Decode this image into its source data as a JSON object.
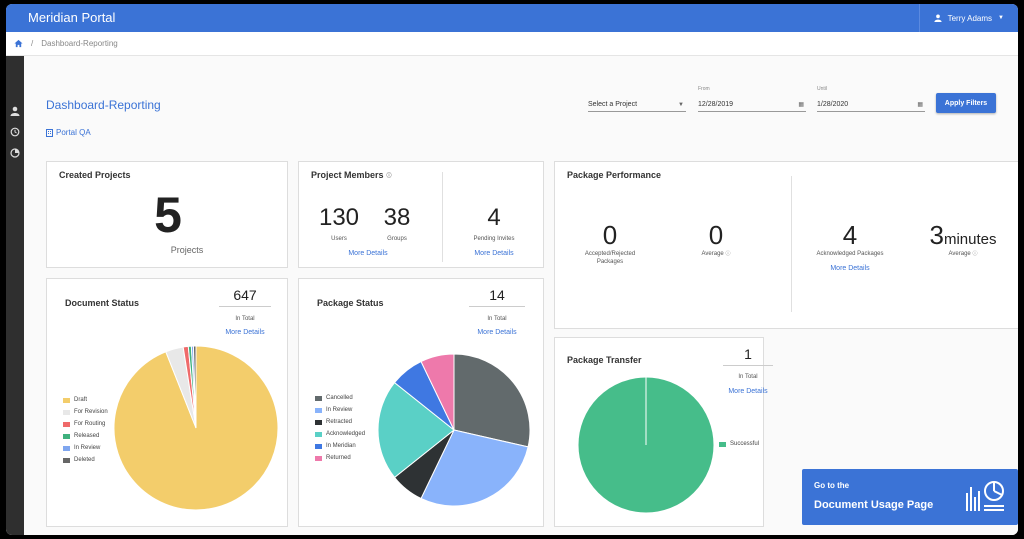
{
  "app": {
    "title": "Meridian Portal",
    "user": "Terry Adams"
  },
  "breadcrumb": {
    "separator": "/",
    "current": "Dashboard-Reporting"
  },
  "page": {
    "title": "Dashboard-Reporting",
    "project_link": "Portal QA"
  },
  "filters": {
    "project_placeholder": "Select a Project",
    "from_label": "From",
    "from_value": "12/28/2019",
    "until_label": "Until",
    "until_value": "1/28/2020",
    "apply_label": "Apply Filters"
  },
  "created_projects": {
    "title": "Created Projects",
    "value": "5",
    "label": "Projects"
  },
  "project_members": {
    "title": "Project Members",
    "users_value": "130",
    "users_label": "Users",
    "groups_value": "38",
    "groups_label": "Groups",
    "pending_value": "4",
    "pending_label": "Pending Invites",
    "more_details": "More Details"
  },
  "package_performance": {
    "title": "Package Performance",
    "accepted_value": "0",
    "accepted_label_1": "Accepted/Rejected",
    "accepted_label_2": "Packages",
    "avg1_value": "0",
    "avg1_label": "Average",
    "ack_value": "4",
    "ack_label": "Acknowledged Packages",
    "avg2_value": "3",
    "avg2_unit": "minutes",
    "avg2_label": "Average",
    "more_details": "More Details"
  },
  "document_status": {
    "title": "Document Status",
    "total": "647",
    "total_label": "In Total",
    "more_details": "More Details",
    "legend": [
      "Draft",
      "For Revision",
      "For Routing",
      "Released",
      "In Review",
      "Deleted"
    ],
    "colors": [
      "#f3cd6b",
      "#e8e8e8",
      "#ef6a6a",
      "#3fb17e",
      "#7fa6ef",
      "#666666"
    ],
    "values": [
      0.94,
      0.035,
      0.01,
      0.006,
      0.004,
      0.005
    ]
  },
  "package_status": {
    "title": "Package Status",
    "total": "14",
    "total_label": "In Total",
    "more_details": "More Details",
    "legend": [
      "Cancelled",
      "In Review",
      "Retracted",
      "Acknowledged",
      "In Meridian",
      "Returned"
    ],
    "colors": [
      "#626a6c",
      "#89b3fb",
      "#2e3234",
      "#5ad0c6",
      "#3f78e2",
      "#ee79ab"
    ],
    "values": [
      4,
      4,
      1,
      3,
      1,
      1
    ]
  },
  "package_transfer": {
    "title": "Package Transfer",
    "total": "1",
    "total_label": "In Total",
    "more_details": "More Details",
    "legend": [
      "Successful"
    ],
    "colors": [
      "#46bd8a"
    ],
    "values": [
      1
    ]
  },
  "doc_usage": {
    "line1": "Go to the",
    "line2": "Document Usage Page"
  }
}
